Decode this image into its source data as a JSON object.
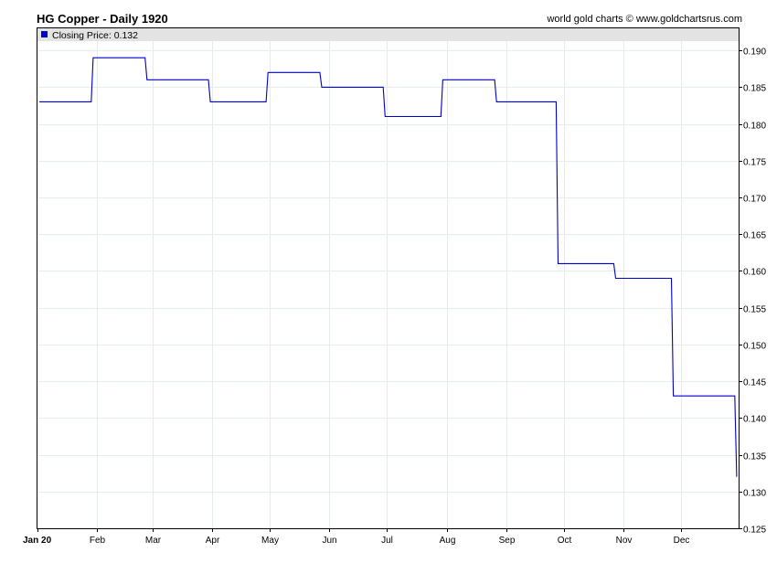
{
  "header": {
    "title": "HG Copper - Daily 1920",
    "credit": "world gold charts © www.goldchartsrus.com"
  },
  "legend": {
    "label": "Closing Price: 0.132",
    "color": "#0000cc"
  },
  "chart_data": {
    "type": "line",
    "title": "HG Copper - Daily 1920",
    "xlabel": "",
    "ylabel": "",
    "line_style": "step",
    "series": [
      {
        "name": "Closing Price",
        "color": "#0000cc",
        "points": [
          {
            "x": "1920-01-02",
            "y": 0.183
          },
          {
            "x": "1920-01-29",
            "y": 0.183
          },
          {
            "x": "1920-01-30",
            "y": 0.189
          },
          {
            "x": "1920-02-26",
            "y": 0.189
          },
          {
            "x": "1920-02-27",
            "y": 0.186
          },
          {
            "x": "1920-03-30",
            "y": 0.186
          },
          {
            "x": "1920-03-31",
            "y": 0.183
          },
          {
            "x": "1920-04-29",
            "y": 0.183
          },
          {
            "x": "1920-04-30",
            "y": 0.187
          },
          {
            "x": "1920-05-27",
            "y": 0.187
          },
          {
            "x": "1920-05-28",
            "y": 0.185
          },
          {
            "x": "1920-06-29",
            "y": 0.185
          },
          {
            "x": "1920-06-30",
            "y": 0.181
          },
          {
            "x": "1920-07-29",
            "y": 0.181
          },
          {
            "x": "1920-07-30",
            "y": 0.186
          },
          {
            "x": "1920-08-26",
            "y": 0.186
          },
          {
            "x": "1920-08-27",
            "y": 0.183
          },
          {
            "x": "1920-09-27",
            "y": 0.183
          },
          {
            "x": "1920-09-28",
            "y": 0.161
          },
          {
            "x": "1920-10-27",
            "y": 0.161
          },
          {
            "x": "1920-10-28",
            "y": 0.159
          },
          {
            "x": "1920-11-26",
            "y": 0.159
          },
          {
            "x": "1920-11-27",
            "y": 0.143
          },
          {
            "x": "1920-12-29",
            "y": 0.143
          },
          {
            "x": "1920-12-30",
            "y": 0.132
          }
        ]
      }
    ],
    "xlim": [
      "1920-01-01",
      "1920-12-31"
    ],
    "ylim": [
      0.125,
      0.193
    ],
    "y_ticks": [
      0.125,
      0.13,
      0.135,
      0.14,
      0.145,
      0.15,
      0.155,
      0.16,
      0.165,
      0.17,
      0.175,
      0.18,
      0.185,
      0.19
    ],
    "y_tick_labels": [
      "0.125",
      "0.130",
      "0.135",
      "0.140",
      "0.145",
      "0.150",
      "0.155",
      "0.160",
      "0.165",
      "0.170",
      "0.175",
      "0.180",
      "0.185",
      "0.190"
    ],
    "x_ticks": [
      "1920-01-01",
      "1920-02-01",
      "1920-03-01",
      "1920-04-01",
      "1920-05-01",
      "1920-06-01",
      "1920-07-01",
      "1920-08-01",
      "1920-09-01",
      "1920-10-01",
      "1920-11-01",
      "1920-12-01"
    ],
    "x_tick_labels": [
      "Jan 20",
      "Feb",
      "Mar",
      "Apr",
      "May",
      "Jun",
      "Jul",
      "Aug",
      "Sep",
      "Oct",
      "Nov",
      "Dec"
    ],
    "y_axis_side": "right",
    "grid": true,
    "legend_position": "top-left"
  }
}
